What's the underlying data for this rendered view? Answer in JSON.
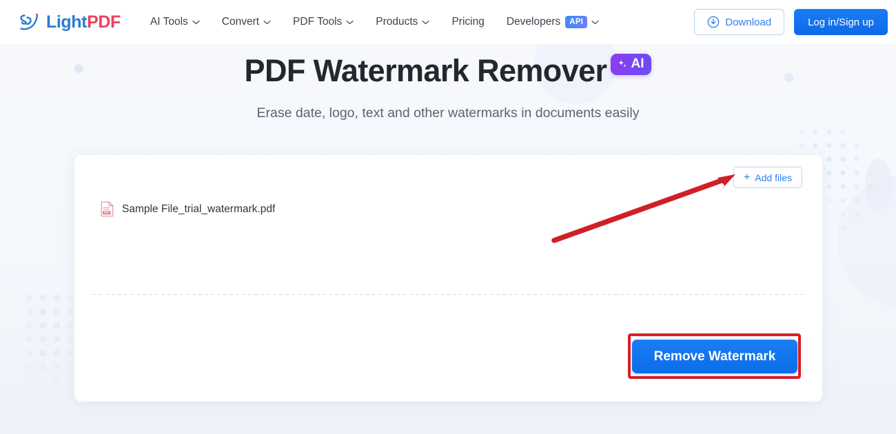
{
  "header": {
    "logo": {
      "light": "Light",
      "pdf": "PDF",
      "icon": "lightpdf-logo-icon"
    },
    "nav": [
      {
        "label": "AI Tools",
        "has_caret": true
      },
      {
        "label": "Convert",
        "has_caret": true
      },
      {
        "label": "PDF Tools",
        "has_caret": true
      },
      {
        "label": "Products",
        "has_caret": true
      },
      {
        "label": "Pricing",
        "has_caret": false
      },
      {
        "label": "Developers",
        "has_caret": true,
        "badge": "API"
      }
    ],
    "download_label": "Download",
    "login_label": "Log in/Sign up"
  },
  "hero": {
    "title": "PDF Watermark Remover",
    "ai_badge": "AI",
    "subtitle": "Erase date, logo, text and other watermarks in documents easily"
  },
  "card": {
    "add_files_label": "Add files",
    "add_files_plus": "+",
    "files": [
      {
        "name": "Sample File_trial_watermark.pdf",
        "icon": "pdf-file-icon"
      }
    ],
    "primary_button": "Remove Watermark"
  },
  "annotations": {
    "arrow": "red-arrow-pointing-to-add-files",
    "highlight_box": "red-box-around-remove-watermark"
  },
  "colors": {
    "accent_blue": "#2d7ff0",
    "logo_blue": "#2b7bd4",
    "logo_red": "#e8415c",
    "ai_purple": "#7b42f0",
    "annotation_red": "#d81f26",
    "page_bg": "#f5f7fb"
  }
}
